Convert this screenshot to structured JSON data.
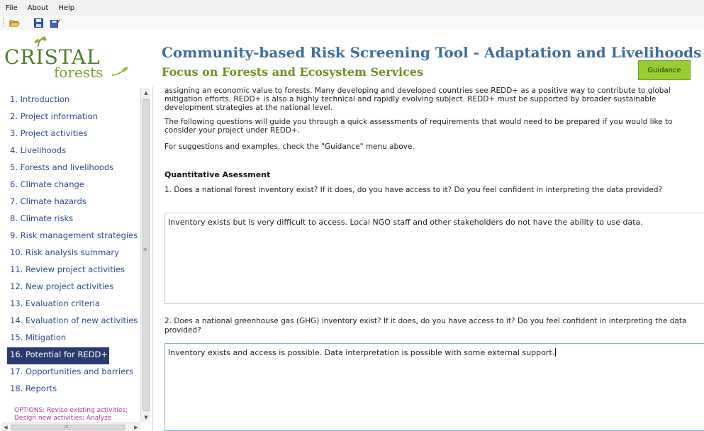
{
  "menu": {
    "items": [
      {
        "label": "File"
      },
      {
        "label": "About"
      },
      {
        "label": "Help"
      }
    ]
  },
  "toolbar": {
    "icons": [
      "open-folder-icon",
      "save-icon",
      "save-as-icon"
    ]
  },
  "header": {
    "logo_main": "CRISTAL",
    "logo_sub": "forests",
    "title": "Community-based Risk Screening Tool - Adaptation and Livelihoods",
    "subtitle": "Focus on Forests and Ecosystem Services",
    "guidance_label": "Guidance"
  },
  "colors": {
    "title_blue": "#3d6f9a",
    "subtitle_green": "#6f8f22",
    "guidance_green": "#9acd32",
    "nav_link": "#2c4b8f",
    "nav_active_bg": "#2b3a6e",
    "options_magenta": "#b0389a"
  },
  "sidebar": {
    "items": [
      {
        "label": "1. Introduction"
      },
      {
        "label": "2. Project information"
      },
      {
        "label": "3. Project activities"
      },
      {
        "label": "4. Livelihoods"
      },
      {
        "label": "5. Forests and livelihoods"
      },
      {
        "label": "6. Climate change"
      },
      {
        "label": "7. Climate hazards"
      },
      {
        "label": "8. Climate risks"
      },
      {
        "label": "9. Risk management strategies"
      },
      {
        "label": "10. Risk analysis summary"
      },
      {
        "label": "11. Review project activities"
      },
      {
        "label": "12. New project activities"
      },
      {
        "label": "13. Evaluation criteria"
      },
      {
        "label": "14. Evaluation of new activities"
      },
      {
        "label": "15. Mitigation"
      },
      {
        "label": "16. Potential for REDD+",
        "active": true
      },
      {
        "label": "17. Opportunities and barriers"
      },
      {
        "label": "18. Reports"
      }
    ],
    "options_text": "OPTIONS: Revise existing activities; Design new activities; Analyze"
  },
  "main": {
    "intro_text": "assigning an economic value to forests. Many developing and developed countries see REDD+ as a positive way to contribute to global mitigation efforts. REDD+ is also a highly technical and rapidly evolving subject. REDD+ must be supported by broader sustainable development strategies at the national level.",
    "paragraph2": "The following questions will guide you through a quick assessments of requirements that would need to be prepared if you would like to consider your project under REDD+.",
    "paragraph3": "For suggestions and examples, check the \"Guidance\" menu above.",
    "section_heading": "Quantitative Asessment",
    "question1": "1. Does a national forest inventory exist? If it does, do you have access to it? Do you feel confident in interpreting the data provided?",
    "answer1": "Inventory exists but is very difficult to access. Local NGO staff and other stakeholders do not have the ability to use data.",
    "question2": "2. Does a national greenhouse gas (GHG) inventory exist? If it does, do you have access to it? Do you feel confident in interpreting the data provided?",
    "answer2": "Inventory exists and access is possible. Data interpretation is possible with some external support."
  }
}
